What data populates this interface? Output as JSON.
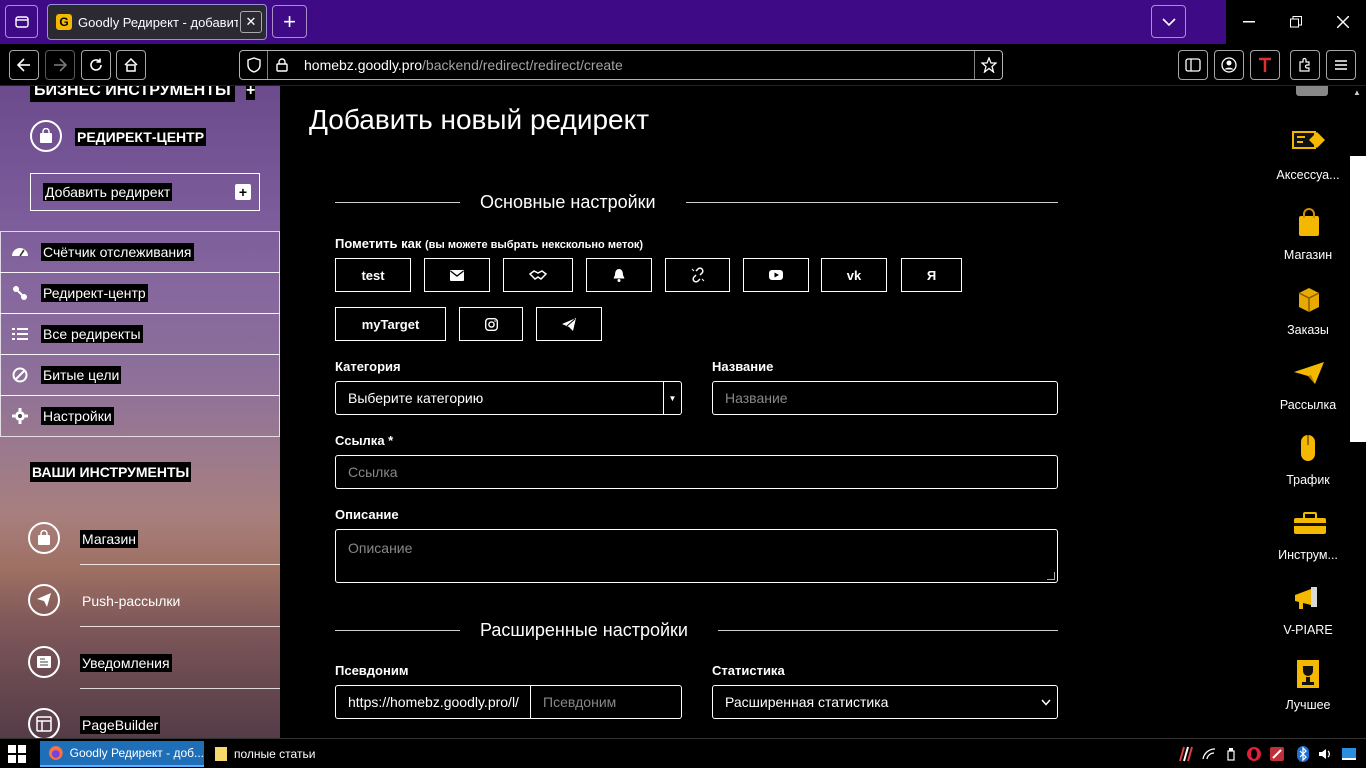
{
  "browser": {
    "tab_title": "Goodly Редирект - добавить",
    "tab_favicon_letter": "G",
    "url_domain": "homebz.goodly.pro",
    "url_path": "/backend/redirect/redirect/create"
  },
  "sidebar": {
    "section1_title": "БИЗНЕС ИНСТРУМЕНТЫ",
    "hub_label": "РЕДИРЕКТ-ЦЕНТР",
    "add_redirect_label": "Добавить редирект",
    "menu": [
      {
        "label": "Счётчик отслеживания",
        "icon": "dashboard-icon"
      },
      {
        "label": "Редирект-центр",
        "icon": "links-icon"
      },
      {
        "label": "Все редиректы",
        "icon": "list-icon"
      },
      {
        "label": "Битые цели",
        "icon": "ban-icon"
      },
      {
        "label": "Настройки",
        "icon": "gear-icon"
      }
    ],
    "section2_title": "ВАШИ ИНСТРУМЕНТЫ",
    "tools": [
      {
        "label": "Магазин",
        "icon": "shopping-bag-icon"
      },
      {
        "label": "Push-рассылки",
        "icon": "paper-plane-icon"
      },
      {
        "label": "Уведомления",
        "icon": "newspaper-icon"
      },
      {
        "label": "PageBuilder",
        "icon": "page-builder-icon"
      }
    ]
  },
  "main": {
    "page_title": "Добавить новый редирект",
    "basic_section": "Основные настройки",
    "tags_label": "Пометить как",
    "tags_hint": "(вы можете выбрать некскольно меток)",
    "tags_row1": [
      {
        "text": "test",
        "icon": ""
      },
      {
        "text": "",
        "icon": "envelope-icon"
      },
      {
        "text": "",
        "icon": "handshake-icon"
      },
      {
        "text": "",
        "icon": "bell-icon"
      },
      {
        "text": "",
        "icon": "broken-link-icon"
      },
      {
        "text": "",
        "icon": "youtube-icon"
      },
      {
        "text": "",
        "icon": "vk-icon"
      },
      {
        "text": "",
        "icon": "yandex-icon"
      }
    ],
    "tags_row2": [
      {
        "text": "myTarget",
        "icon": ""
      },
      {
        "text": "",
        "icon": "instagram-icon"
      },
      {
        "text": "",
        "icon": "telegram-icon"
      }
    ],
    "vk_text": "vk",
    "ya_text": "Я",
    "category_label": "Категория",
    "category_value": "Выберите категорию",
    "name_label": "Название",
    "name_placeholder": "Название",
    "link_label": "Ссылка *",
    "link_placeholder": "Ссылка",
    "desc_label": "Описание",
    "desc_placeholder": "Описание",
    "advanced_section": "Расширенные настройки",
    "alias_label": "Псевдоним",
    "alias_prefix": "https://homebz.goodly.pro/l/",
    "alias_placeholder": "Псевдоним",
    "stats_label": "Статистика",
    "stats_value": "Расширенная статистика"
  },
  "apps": [
    {
      "label": "Аксессуа...",
      "icon": "accessories-icon"
    },
    {
      "label": "Магазин",
      "icon": "shop-bag-icon"
    },
    {
      "label": "Заказы",
      "icon": "orders-box-icon"
    },
    {
      "label": "Рассылка",
      "icon": "mailing-plane-icon"
    },
    {
      "label": "Трафик",
      "icon": "traffic-mouse-icon"
    },
    {
      "label": "Инструм...",
      "icon": "toolbox-icon"
    },
    {
      "label": "V-PIARE",
      "icon": "megaphone-icon"
    },
    {
      "label": "Лучшее",
      "icon": "trophy-icon"
    }
  ],
  "taskbar": {
    "item1": "Goodly Редирект - доб...",
    "item2": "полные статьи"
  },
  "colors": {
    "tab_strip": "#3f0a86",
    "taskbar_active": "#1f6fb8",
    "accent_yellow": "#f5b800"
  }
}
